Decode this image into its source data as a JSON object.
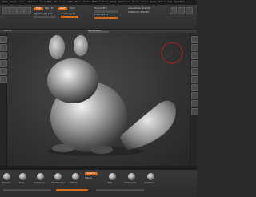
{
  "app": {
    "accent_color": "#d86a1d",
    "panel_color": "#3a3a3a",
    "viewport_color": "#3a3a3a"
  },
  "menubar": {
    "items": [
      "Alpha",
      "Brush",
      "Color",
      "Document",
      "Draw",
      "Edit",
      "File",
      "Layer",
      "Light",
      "Macro",
      "Marker",
      "Material",
      "Movie",
      "Picker",
      "Preferences",
      "Render",
      "Stencil",
      "Stroke",
      "Texture",
      "Tool",
      "Transform"
    ]
  },
  "top_shelf": {
    "rgb_label": "Rgb",
    "mrgb_label": "Mrgb",
    "m_label": "M",
    "zadd_label": "Zadd",
    "zsub_label": "Zsub",
    "focal_label": "Focal Shift 0",
    "draw_size_label": "Draw Size 64",
    "rgb_intensity_label": "Rgb Intensity 100",
    "z_intensity_label": "Z Intensity 25",
    "active_points_label": "ActivePoints: 216,587",
    "total_points_label": "TotalPoints: 216,587"
  },
  "tabs": [
    "Lightbox",
    "Live Boolean"
  ],
  "bottom_shelf": {
    "brushes": [
      "Standard",
      "Move",
      "ClayBuildup",
      "DamStandard",
      "hPolish",
      "Inflat",
      "TrimDynamic",
      "SnakeHook"
    ],
    "button_label": "Dynamic",
    "subdiv_label": "SDiv 4"
  }
}
